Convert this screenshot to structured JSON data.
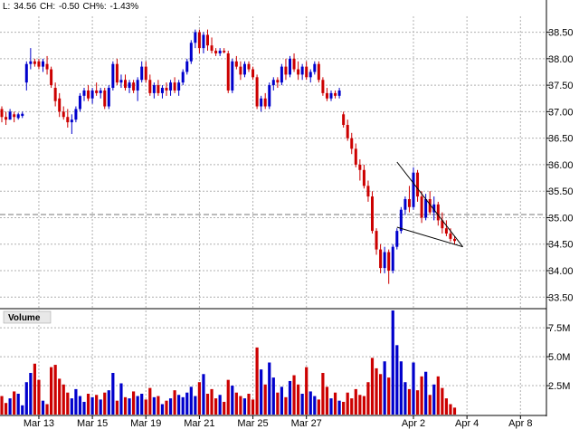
{
  "quote": {
    "last_label": "L:",
    "last": "34.56",
    "change_label": "CH:",
    "change": "-0.50",
    "change_pct_label": "CH%:",
    "change_pct": "-1.43%"
  },
  "volume_label": "Volume",
  "colors": {
    "up": "#0000cc",
    "down": "#cc0000",
    "grid": "#b0b0b0",
    "trendline": "#000000"
  },
  "chart_data": [
    {
      "type": "candlestick",
      "title": "",
      "ylim": [
        33.3,
        38.8
      ],
      "yticks": [
        "33.50",
        "34.00",
        "34.50",
        "35.00",
        "35.50",
        "36.00",
        "36.50",
        "37.00",
        "37.50",
        "38.00",
        "38.50"
      ],
      "xticks": [
        "Mar 13",
        "Mar 15",
        "Mar 19",
        "Mar 21",
        "Mar 25",
        "Mar 27",
        "Apr 2",
        "Apr 4",
        "Apr 8"
      ],
      "reference_level": 35.06,
      "grid": true,
      "bars_per_day": 13,
      "trendlines": [
        {
          "from": [
            35.72,
            36.05
          ],
          "to": [
            35.92,
            34.45
          ]
        },
        {
          "from": [
            35.71,
            34.82
          ],
          "to": [
            35.92,
            34.45
          ]
        }
      ],
      "ohlc": [
        [
          37.05,
          37.1,
          36.8,
          36.9
        ],
        [
          36.9,
          37.0,
          36.75,
          36.85
        ],
        [
          36.85,
          37.05,
          36.85,
          37.0
        ],
        [
          36.95,
          37.0,
          36.8,
          36.9
        ],
        [
          36.88,
          36.98,
          36.85,
          36.95
        ],
        [
          36.92,
          37.0,
          36.88,
          36.96
        ],
        [
          37.55,
          37.95,
          37.4,
          37.9
        ],
        [
          37.9,
          38.2,
          37.8,
          37.95
        ],
        [
          37.95,
          38.0,
          37.85,
          37.9
        ],
        [
          37.95,
          38.0,
          37.8,
          37.85
        ],
        [
          37.85,
          38.0,
          37.75,
          37.95
        ],
        [
          37.9,
          38.05,
          37.7,
          37.8
        ],
        [
          37.8,
          37.85,
          37.45,
          37.5
        ],
        [
          37.45,
          37.55,
          37.1,
          37.2
        ],
        [
          37.25,
          37.35,
          36.9,
          37.0
        ],
        [
          37.0,
          37.1,
          36.85,
          36.9
        ],
        [
          36.9,
          37.05,
          36.7,
          36.8
        ],
        [
          36.8,
          36.95,
          36.58,
          36.85
        ],
        [
          36.85,
          37.1,
          36.8,
          37.05
        ],
        [
          37.05,
          37.35,
          37.0,
          37.3
        ],
        [
          37.3,
          37.45,
          37.2,
          37.4
        ],
        [
          37.4,
          37.5,
          37.2,
          37.25
        ],
        [
          37.25,
          37.45,
          37.15,
          37.4
        ],
        [
          37.4,
          37.55,
          37.3,
          37.35
        ],
        [
          37.35,
          37.45,
          37.25,
          37.4
        ],
        [
          37.4,
          37.45,
          37.05,
          37.1
        ],
        [
          37.1,
          37.5,
          37.05,
          37.45
        ],
        [
          37.45,
          37.95,
          37.4,
          37.9
        ],
        [
          37.9,
          38.0,
          37.5,
          37.55
        ],
        [
          37.55,
          37.7,
          37.45,
          37.6
        ],
        [
          37.6,
          37.7,
          37.4,
          37.45
        ],
        [
          37.45,
          37.6,
          37.35,
          37.55
        ],
        [
          37.55,
          37.6,
          37.35,
          37.4
        ],
        [
          37.4,
          37.65,
          37.2,
          37.6
        ],
        [
          37.6,
          37.95,
          37.55,
          37.85
        ],
        [
          37.85,
          37.95,
          37.55,
          37.6
        ],
        [
          37.6,
          37.7,
          37.3,
          37.35
        ],
        [
          37.35,
          37.55,
          37.25,
          37.5
        ],
        [
          37.5,
          37.6,
          37.3,
          37.35
        ],
        [
          37.35,
          37.5,
          37.25,
          37.45
        ],
        [
          37.45,
          37.55,
          37.3,
          37.4
        ],
        [
          37.4,
          37.6,
          37.3,
          37.55
        ],
        [
          37.55,
          37.65,
          37.35,
          37.4
        ],
        [
          37.4,
          37.6,
          37.3,
          37.55
        ],
        [
          37.55,
          37.8,
          37.5,
          37.75
        ],
        [
          37.75,
          38.0,
          37.7,
          37.95
        ],
        [
          37.95,
          38.35,
          37.9,
          38.3
        ],
        [
          38.3,
          38.55,
          38.2,
          38.5
        ],
        [
          38.5,
          38.55,
          38.1,
          38.2
        ],
        [
          38.2,
          38.5,
          38.1,
          38.45
        ],
        [
          38.45,
          38.55,
          38.15,
          38.25
        ],
        [
          38.25,
          38.4,
          38.1,
          38.15
        ],
        [
          38.15,
          38.2,
          38.05,
          38.1
        ],
        [
          38.1,
          38.2,
          38.05,
          38.15
        ],
        [
          38.15,
          38.2,
          38.1,
          38.12
        ],
        [
          38.1,
          38.15,
          37.35,
          37.4
        ],
        [
          37.4,
          38.0,
          37.35,
          37.95
        ],
        [
          37.95,
          38.05,
          37.8,
          37.85
        ],
        [
          37.85,
          37.95,
          37.6,
          37.7
        ],
        [
          37.7,
          37.95,
          37.65,
          37.9
        ],
        [
          37.9,
          37.95,
          37.75,
          37.8
        ],
        [
          37.8,
          37.85,
          37.6,
          37.65
        ],
        [
          37.65,
          37.7,
          37.05,
          37.1
        ],
        [
          37.1,
          37.3,
          37.0,
          37.25
        ],
        [
          37.25,
          37.35,
          37.05,
          37.1
        ],
        [
          37.1,
          37.55,
          37.05,
          37.5
        ],
        [
          37.5,
          37.65,
          37.4,
          37.6
        ],
        [
          37.6,
          37.65,
          37.45,
          37.55
        ],
        [
          37.55,
          37.9,
          37.5,
          37.85
        ],
        [
          37.85,
          38.0,
          37.6,
          37.7
        ],
        [
          37.7,
          38.05,
          37.65,
          38.0
        ],
        [
          38.0,
          38.1,
          37.75,
          37.8
        ],
        [
          37.8,
          37.95,
          37.6,
          37.7
        ],
        [
          37.7,
          37.9,
          37.6,
          37.85
        ],
        [
          37.85,
          37.95,
          37.6,
          37.65
        ],
        [
          37.65,
          37.8,
          37.55,
          37.75
        ],
        [
          37.75,
          37.95,
          37.7,
          37.9
        ],
        [
          37.9,
          37.95,
          37.55,
          37.6
        ],
        [
          37.6,
          37.65,
          37.3,
          37.35
        ],
        [
          37.35,
          37.45,
          37.2,
          37.25
        ],
        [
          37.25,
          37.4,
          37.2,
          37.35
        ],
        [
          37.35,
          37.4,
          37.25,
          37.3
        ],
        [
          37.3,
          37.45,
          37.25,
          37.4
        ],
        [
          36.95,
          37.0,
          36.7,
          36.75
        ],
        [
          36.75,
          36.85,
          36.45,
          36.5
        ],
        [
          36.5,
          36.6,
          36.2,
          36.3
        ],
        [
          36.3,
          36.4,
          35.95,
          36.0
        ],
        [
          36.0,
          36.1,
          35.7,
          35.9
        ],
        [
          35.9,
          36.0,
          35.55,
          35.6
        ],
        [
          35.6,
          35.7,
          35.3,
          35.4
        ],
        [
          35.4,
          35.5,
          34.7,
          34.75
        ],
        [
          34.75,
          34.8,
          34.3,
          34.4
        ],
        [
          34.4,
          34.5,
          33.95,
          34.05
        ],
        [
          34.05,
          34.45,
          33.95,
          34.35
        ],
        [
          34.35,
          34.4,
          33.75,
          34.0
        ],
        [
          34.0,
          34.5,
          33.95,
          34.45
        ],
        [
          34.45,
          34.8,
          34.4,
          34.75
        ],
        [
          34.75,
          35.2,
          34.7,
          35.15
        ],
        [
          35.15,
          35.4,
          35.05,
          35.35
        ],
        [
          35.35,
          35.6,
          35.1,
          35.2
        ],
        [
          35.2,
          35.95,
          35.15,
          35.85
        ],
        [
          35.85,
          35.9,
          35.3,
          35.4
        ],
        [
          35.4,
          35.5,
          34.9,
          35.0
        ],
        [
          35.0,
          35.45,
          34.95,
          35.35
        ],
        [
          35.35,
          35.5,
          35.05,
          35.1
        ],
        [
          35.1,
          35.4,
          34.95,
          35.25
        ],
        [
          35.25,
          35.3,
          34.85,
          34.95
        ],
        [
          34.95,
          35.1,
          34.7,
          34.8
        ],
        [
          34.8,
          34.95,
          34.65,
          34.7
        ],
        [
          34.7,
          34.8,
          34.55,
          34.6
        ],
        [
          34.6,
          34.65,
          34.5,
          34.56
        ]
      ]
    },
    {
      "type": "bar",
      "title": "Volume",
      "ylim": [
        0,
        9000000
      ],
      "yticks": [
        "2.5M",
        "5.0M",
        "7.5M"
      ],
      "volume": [
        1.6,
        1.0,
        1.4,
        2.0,
        1.8,
        0.8,
        2.8,
        3.6,
        4.4,
        3.0,
        1.2,
        0.9,
        4.1,
        4.3,
        3.1,
        2.6,
        1.9,
        1.4,
        2.2,
        1.6,
        1.1,
        1.8,
        1.5,
        1.7,
        1.3,
        1.9,
        2.1,
        3.6,
        1.2,
        2.7,
        1.5,
        1.4,
        2.0,
        1.6,
        1.8,
        1.3,
        2.3,
        1.5,
        1.6,
        0.9,
        1.2,
        1.4,
        2.1,
        1.7,
        1.5,
        1.9,
        2.4,
        1.6,
        2.8,
        3.5,
        1.8,
        2.2,
        1.4,
        1.7,
        1.1,
        3.0,
        2.5,
        1.9,
        1.6,
        1.4,
        1.8,
        1.3,
        5.8,
        3.9,
        2.6,
        4.5,
        3.2,
        1.9,
        2.4,
        1.5,
        2.9,
        3.4,
        2.6,
        1.8,
        4.1,
        2.0,
        1.6,
        1.3,
        3.6,
        2.4,
        1.4,
        1.9,
        1.2,
        1.1,
        1.9,
        1.4,
        2.2,
        1.7,
        1.6,
        2.8,
        4.9,
        4.0,
        3.5,
        4.6,
        3.2,
        9.0,
        6.0,
        4.6,
        2.8,
        2.2,
        4.5,
        2.1,
        3.3,
        3.7,
        1.7,
        2.6,
        3.3,
        2.3,
        1.4,
        0.9,
        0.6
      ]
    }
  ]
}
